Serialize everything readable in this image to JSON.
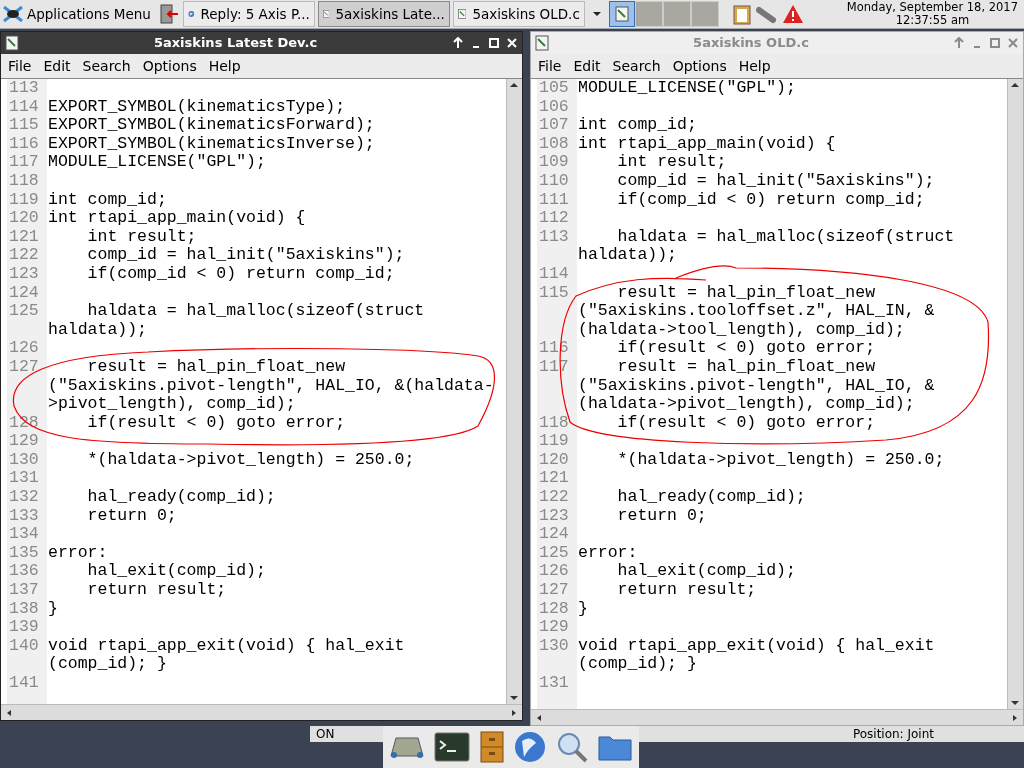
{
  "taskbar": {
    "app_menu": "Applications Menu",
    "tasks": [
      {
        "label": "Reply: 5 Axis P...",
        "selected": false
      },
      {
        "label": "5axiskins Late...",
        "selected": true
      },
      {
        "label": "5axiskins OLD.c",
        "selected": false
      }
    ],
    "clock": {
      "date": "Monday, September 18, 2017",
      "time": "12:37:55 am"
    }
  },
  "windows": [
    {
      "title": "5axiskins Latest Dev.c",
      "active": true,
      "menu": [
        "File",
        "Edit",
        "Search",
        "Options",
        "Help"
      ],
      "lines": [
        {
          "number": "113"
        },
        {
          "number": "114",
          "text": [
            "EXPORT_SYMBOL(kinematicsType);"
          ]
        },
        {
          "number": "115",
          "text": [
            "EXPORT_SYMBOL(kinematicsForward);"
          ]
        },
        {
          "number": "116",
          "text": [
            "EXPORT_SYMBOL(kinematicsInverse);"
          ]
        },
        {
          "number": "117",
          "text": [
            "MODULE_LICENSE(\"GPL\");"
          ]
        },
        {
          "number": "118"
        },
        {
          "number": "119",
          "text": [
            "int comp_id;"
          ]
        },
        {
          "number": "120",
          "text": [
            "int rtapi_app_main(void) {"
          ]
        },
        {
          "number": "121",
          "text": [
            "    int result;"
          ]
        },
        {
          "number": "122",
          "text": [
            "    comp_id = hal_init(\"5axiskins\");"
          ]
        },
        {
          "number": "123",
          "text": [
            "    if(comp_id < 0) return comp_id;"
          ]
        },
        {
          "number": "124"
        },
        {
          "number": "125",
          "text": [
            "    haldata = hal_malloc(sizeof(struct",
            "haldata));"
          ]
        },
        {
          "number": "126"
        },
        {
          "number": "127",
          "text": [
            "    result = hal_pin_float_new",
            "(\"5axiskins.pivot-length\", HAL_IO, &(haldata-",
            ">pivot_length), comp_id);"
          ]
        },
        {
          "number": "128",
          "text": [
            "    if(result < 0) goto error;"
          ]
        },
        {
          "number": "129"
        },
        {
          "number": "130",
          "text": [
            "    *(haldata->pivot_length) = 250.0;"
          ]
        },
        {
          "number": "131"
        },
        {
          "number": "132",
          "text": [
            "    hal_ready(comp_id);"
          ]
        },
        {
          "number": "133",
          "text": [
            "    return 0;"
          ]
        },
        {
          "number": "134"
        },
        {
          "number": "135",
          "text": [
            "error:"
          ]
        },
        {
          "number": "136",
          "text": [
            "    hal_exit(comp_id);"
          ]
        },
        {
          "number": "137",
          "text": [
            "    return result;"
          ]
        },
        {
          "number": "138",
          "text": [
            "}"
          ]
        },
        {
          "number": "139"
        },
        {
          "number": "140",
          "text": [
            "void rtapi_app_exit(void) { hal_exit",
            "(comp_id); }"
          ]
        },
        {
          "number": "141"
        }
      ]
    },
    {
      "title": "5axiskins OLD.c",
      "active": false,
      "menu": [
        "File",
        "Edit",
        "Search",
        "Options",
        "Help"
      ],
      "lines": [
        {
          "number": "105",
          "text": [
            "MODULE_LICENSE(\"GPL\");"
          ]
        },
        {
          "number": "106"
        },
        {
          "number": "107",
          "text": [
            "int comp_id;"
          ]
        },
        {
          "number": "108",
          "text": [
            "int rtapi_app_main(void) {"
          ]
        },
        {
          "number": "109",
          "text": [
            "    int result;"
          ]
        },
        {
          "number": "110",
          "text": [
            "    comp_id = hal_init(\"5axiskins\");"
          ]
        },
        {
          "number": "111",
          "text": [
            "    if(comp_id < 0) return comp_id;"
          ]
        },
        {
          "number": "112"
        },
        {
          "number": "113",
          "text": [
            "    haldata = hal_malloc(sizeof(struct",
            "haldata));"
          ]
        },
        {
          "number": "114"
        },
        {
          "number": "115",
          "text": [
            "    result = hal_pin_float_new",
            "(\"5axiskins.tooloffset.z\", HAL_IN, &",
            "(haldata->tool_length), comp_id);"
          ]
        },
        {
          "number": "116",
          "text": [
            "    if(result < 0) goto error;"
          ]
        },
        {
          "number": "117",
          "text": [
            "    result = hal_pin_float_new",
            "(\"5axiskins.pivot-length\", HAL_IO, &",
            "(haldata->pivot_length), comp_id);"
          ]
        },
        {
          "number": "118",
          "text": [
            "    if(result < 0) goto error;"
          ]
        },
        {
          "number": "119"
        },
        {
          "number": "120",
          "text": [
            "    *(haldata->pivot_length) = 250.0;"
          ]
        },
        {
          "number": "121"
        },
        {
          "number": "122",
          "text": [
            "    hal_ready(comp_id);"
          ]
        },
        {
          "number": "123",
          "text": [
            "    return 0;"
          ]
        },
        {
          "number": "124"
        },
        {
          "number": "125",
          "text": [
            "error:"
          ]
        },
        {
          "number": "126",
          "text": [
            "    hal_exit(comp_id);"
          ]
        },
        {
          "number": "127",
          "text": [
            "    return result;"
          ]
        },
        {
          "number": "128",
          "text": [
            "}"
          ]
        },
        {
          "number": "129"
        },
        {
          "number": "130",
          "text": [
            "void rtapi_app_exit(void) { hal_exit",
            "(comp_id); }"
          ]
        },
        {
          "number": "131"
        }
      ]
    }
  ],
  "background_window": {
    "status": [
      "ON",
      "Position: Joint"
    ]
  }
}
